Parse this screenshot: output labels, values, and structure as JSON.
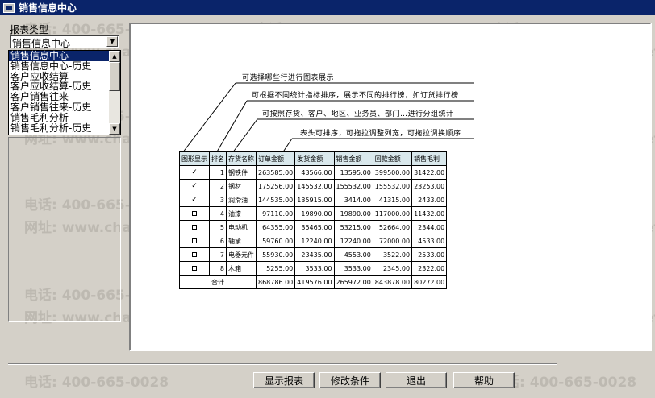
{
  "window": {
    "title": "销售信息中心",
    "icon": "app-window-icon"
  },
  "watermark": {
    "phone": "电话: 400-665-0028",
    "url": "网址: www.chanjet.net"
  },
  "left": {
    "report_type_label": "报表类型",
    "combo_value": "销售信息中心",
    "list_items": [
      "销售信息中心",
      "销售信息中心-历史",
      "客户应收结算",
      "客户应收结算-历史",
      "客户销售往来",
      "客户销售往来-历史",
      "销售毛利分析",
      "销售毛利分析-历史"
    ],
    "selected_index": 0
  },
  "annotations": [
    "可选择哪些行进行图表展示",
    "可根据不同统计指标排序，展示不同的排行榜，如订货排行榜",
    "可按照存货、客户、地区、业务员、部门…进行分组统计",
    "表头可排序，可拖拉调整列宽，可拖拉调换顺序"
  ],
  "grid": {
    "headers": [
      "图形显示",
      "排名",
      "存货名称",
      "订单金额",
      "发货金额",
      "销售金额",
      "回款金额",
      "销售毛利"
    ],
    "rows": [
      {
        "shown": true,
        "rank": "1",
        "name": "钢铁件",
        "order": "263585.00",
        "ship": "43566.00",
        "sales": "13595.00",
        "receipt": "399500.00",
        "margin": "31422.00"
      },
      {
        "shown": true,
        "rank": "2",
        "name": "钢材",
        "order": "175256.00",
        "ship": "145532.00",
        "sales": "155532.00",
        "receipt": "155532.00",
        "margin": "23253.00"
      },
      {
        "shown": true,
        "rank": "3",
        "name": "润滑油",
        "order": "144535.00",
        "ship": "135915.00",
        "sales": "3414.00",
        "receipt": "41315.00",
        "margin": "2433.00"
      },
      {
        "shown": false,
        "rank": "4",
        "name": "油漆",
        "order": "97110.00",
        "ship": "19890.00",
        "sales": "19890.00",
        "receipt": "117000.00",
        "margin": "11432.00"
      },
      {
        "shown": false,
        "rank": "5",
        "name": "电动机",
        "order": "64355.00",
        "ship": "35465.00",
        "sales": "53215.00",
        "receipt": "52664.00",
        "margin": "2344.00"
      },
      {
        "shown": false,
        "rank": "6",
        "name": "轴承",
        "order": "59760.00",
        "ship": "12240.00",
        "sales": "12240.00",
        "receipt": "72000.00",
        "margin": "4533.00"
      },
      {
        "shown": false,
        "rank": "7",
        "name": "电器元件",
        "order": "55930.00",
        "ship": "23435.00",
        "sales": "4553.00",
        "receipt": "3522.00",
        "margin": "2533.00"
      },
      {
        "shown": false,
        "rank": "8",
        "name": "木箱",
        "order": "5255.00",
        "ship": "3533.00",
        "sales": "3533.00",
        "receipt": "2345.00",
        "margin": "2322.00"
      }
    ],
    "total": {
      "label": "合计",
      "order": "868786.00",
      "ship": "419576.00",
      "sales": "265972.00",
      "receipt": "843878.00",
      "margin": "80272.00"
    },
    "check_mark": "✓"
  },
  "buttons": {
    "show_report": "显示报表",
    "modify_conditions": "修改条件",
    "exit": "退出",
    "help": "帮助"
  },
  "colors": {
    "title_bar": "#0a246a",
    "header_fill": "#d9e8ec",
    "face": "#d4d0c8"
  }
}
